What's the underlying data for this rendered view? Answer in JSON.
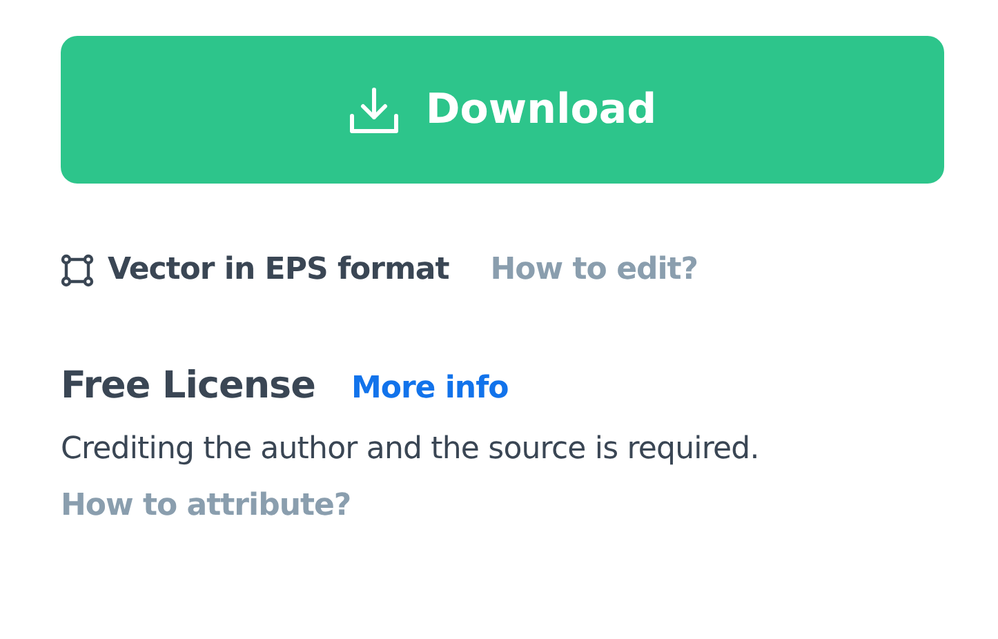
{
  "download_button": {
    "label": "Download"
  },
  "format": {
    "label": "Vector in EPS format",
    "link": "How to edit?"
  },
  "license": {
    "title": "Free License",
    "link": "More info",
    "description": "Crediting the author and the source is required.",
    "attribution_link": "How to attribute?"
  }
}
